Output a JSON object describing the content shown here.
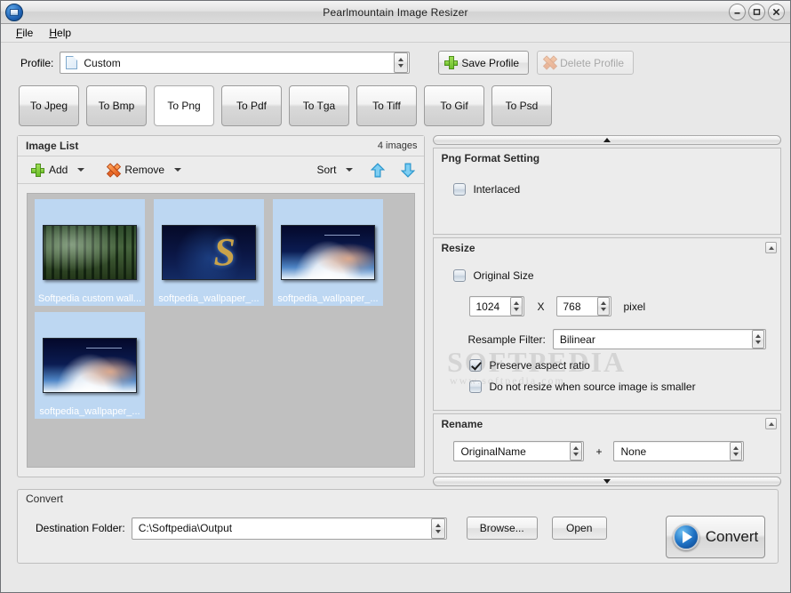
{
  "window": {
    "title": "Pearlmountain Image Resizer",
    "icon": "app-icon",
    "minimize": "–",
    "maximize": "□",
    "close": "×"
  },
  "menubar": {
    "items": [
      {
        "label": "File",
        "accel": "F"
      },
      {
        "label": "Help",
        "accel": "H"
      }
    ]
  },
  "profile": {
    "label": "Profile:",
    "value": "Custom",
    "save_label": "Save Profile",
    "delete_label": "Delete Profile",
    "delete_disabled": true
  },
  "tabs": [
    {
      "label": "To Jpeg",
      "active": false
    },
    {
      "label": "To Bmp",
      "active": false
    },
    {
      "label": "To Png",
      "active": true
    },
    {
      "label": "To Pdf",
      "active": false
    },
    {
      "label": "To Tga",
      "active": false
    },
    {
      "label": "To Tiff",
      "active": false
    },
    {
      "label": "To Gif",
      "active": false
    },
    {
      "label": "To Psd",
      "active": false
    }
  ],
  "image_list": {
    "title": "Image List",
    "count_label": "4 images",
    "toolbar": {
      "add": "Add",
      "remove": "Remove",
      "sort": "Sort"
    },
    "items": [
      {
        "caption": "Softpedia custom wall...",
        "art": "forest"
      },
      {
        "caption": "softpedia_wallpaper_...",
        "art": "s-logo"
      },
      {
        "caption": "softpedia_wallpaper_...",
        "art": "girl"
      },
      {
        "caption": "softpedia_wallpaper_...",
        "art": "girl"
      }
    ]
  },
  "png_format": {
    "title": "Png Format Setting",
    "interlaced_label": "Interlaced",
    "interlaced_checked": false
  },
  "resize": {
    "title": "Resize",
    "original_size_label": "Original Size",
    "original_size_checked": false,
    "width": "1024",
    "separator": "X",
    "height": "768",
    "unit": "pixel",
    "resample_label": "Resample Filter:",
    "resample_value": "Bilinear",
    "preserve_aspect_label": "Preserve aspect ratio",
    "preserve_aspect_checked": true,
    "no_upscale_label": "Do not resize when source image is smaller",
    "no_upscale_checked": false
  },
  "rename": {
    "title": "Rename",
    "first_value": "OriginalName",
    "plus": "+",
    "second_value": "None"
  },
  "convert": {
    "title": "Convert",
    "dest_label": "Destination Folder:",
    "dest_value": "C:\\Softpedia\\Output",
    "browse_label": "Browse...",
    "open_label": "Open",
    "convert_label": "Convert"
  },
  "watermark": {
    "line1": "SOFTPEDIA",
    "line2": "www.softpedia.com"
  },
  "colors": {
    "window_bg": "#e8e8e8",
    "panel_bg": "#ececec",
    "thumb_area_bg": "#c0c0c0",
    "thumb_selected_bg": "#bdd7f2",
    "accent_green": "#6cbf2a",
    "accent_orange": "#e4591a",
    "accent_blue": "#1f72c4"
  }
}
